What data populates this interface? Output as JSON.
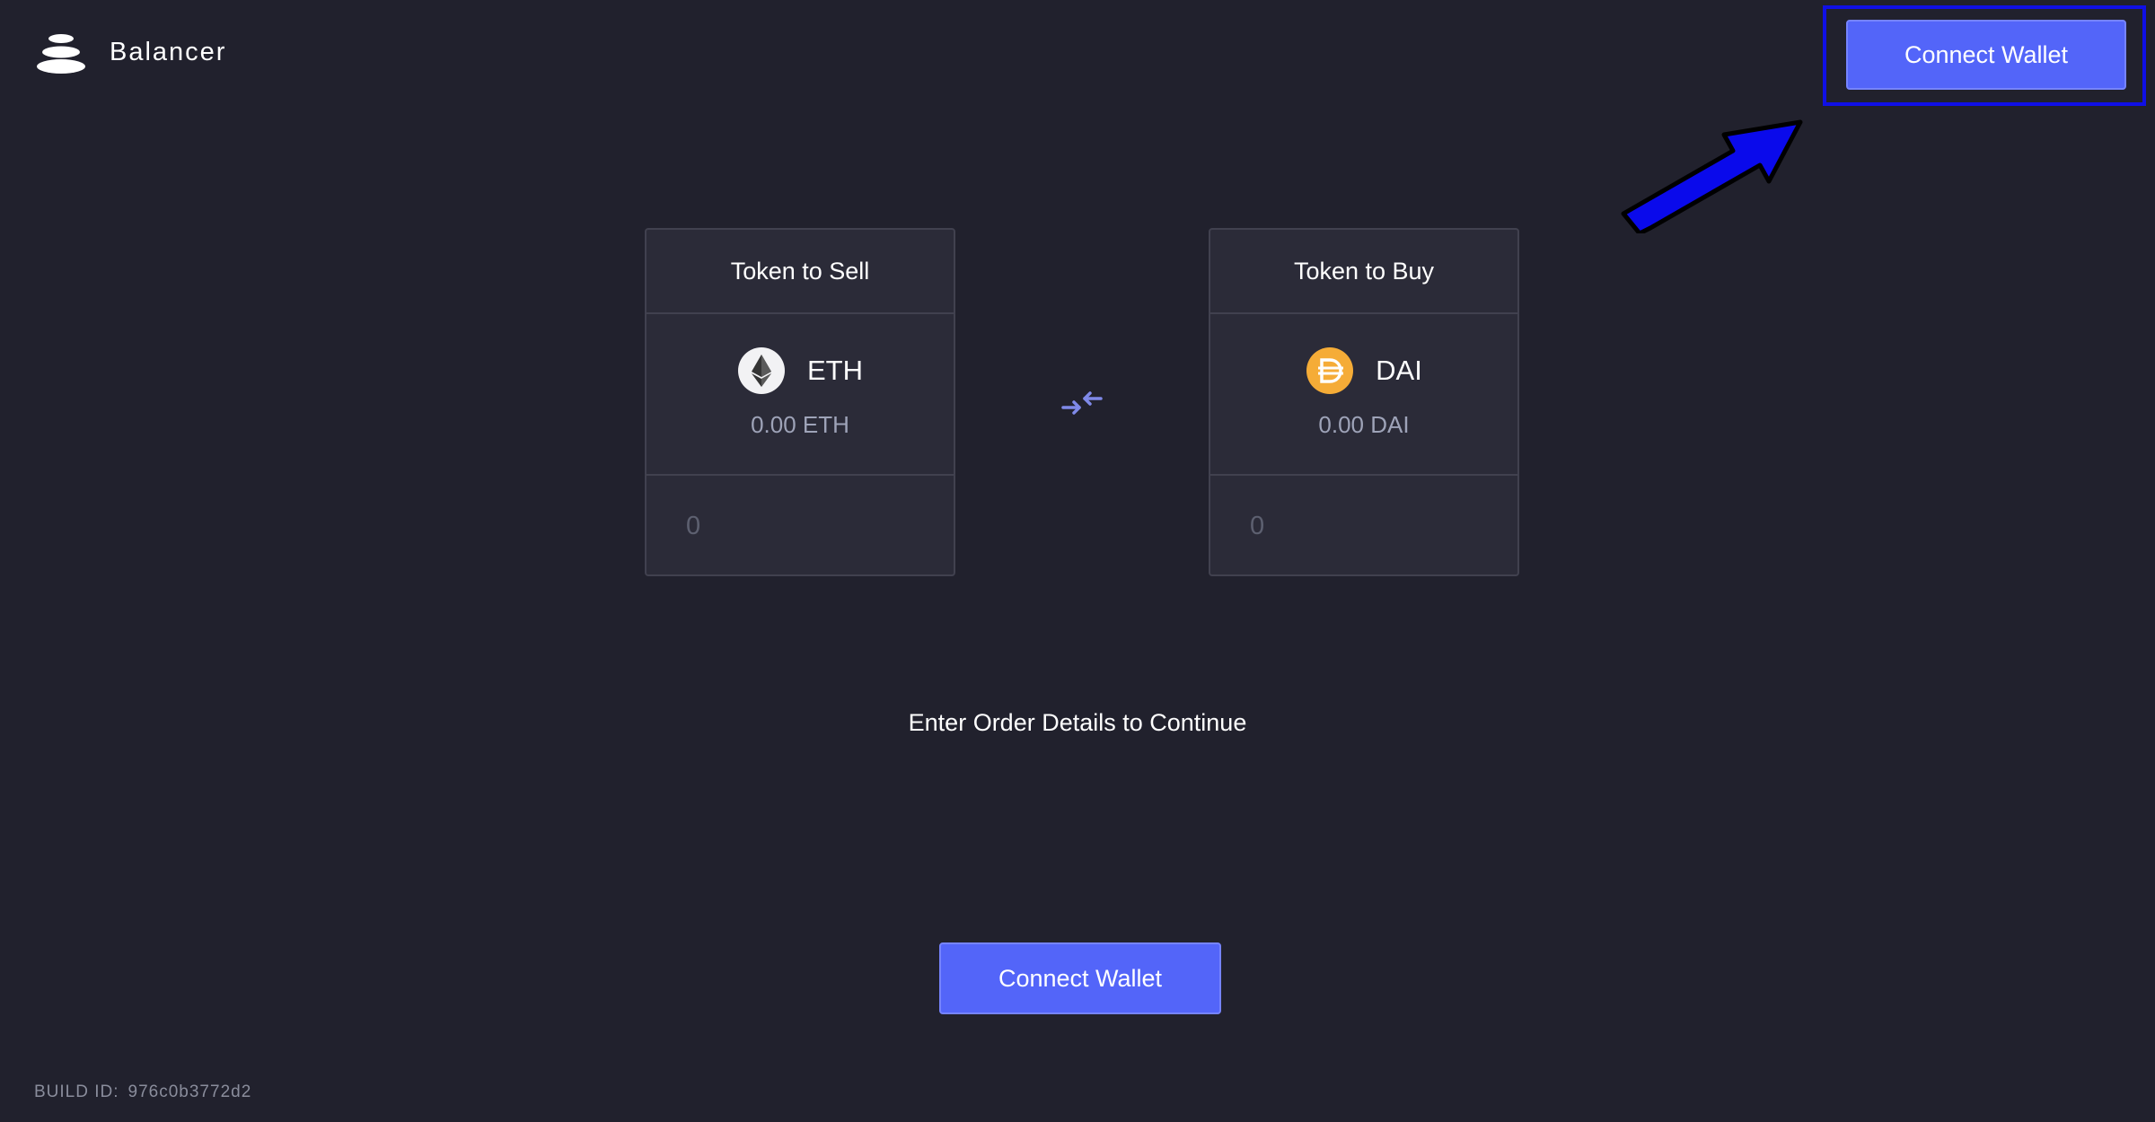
{
  "header": {
    "brand_name": "Balancer",
    "connect_label": "Connect Wallet"
  },
  "sell_panel": {
    "title": "Token to Sell",
    "token_symbol": "ETH",
    "token_icon": "ethereum-icon",
    "balance": "0.00 ETH",
    "amount_placeholder": "0"
  },
  "buy_panel": {
    "title": "Token to Buy",
    "token_symbol": "DAI",
    "token_icon": "dai-icon",
    "balance": "0.00 DAI",
    "amount_placeholder": "0"
  },
  "swap_icon": "swap-arrows-icon",
  "status_message": "Enter Order Details to Continue",
  "main_action": {
    "connect_label": "Connect Wallet"
  },
  "footer": {
    "build_label": "BUILD ID:",
    "build_id": "976c0b3772d2"
  },
  "colors": {
    "background": "#21212d",
    "panel": "#2b2b38",
    "accent": "#5365f9",
    "highlight": "#1010e6",
    "dai": "#f5ac37"
  }
}
